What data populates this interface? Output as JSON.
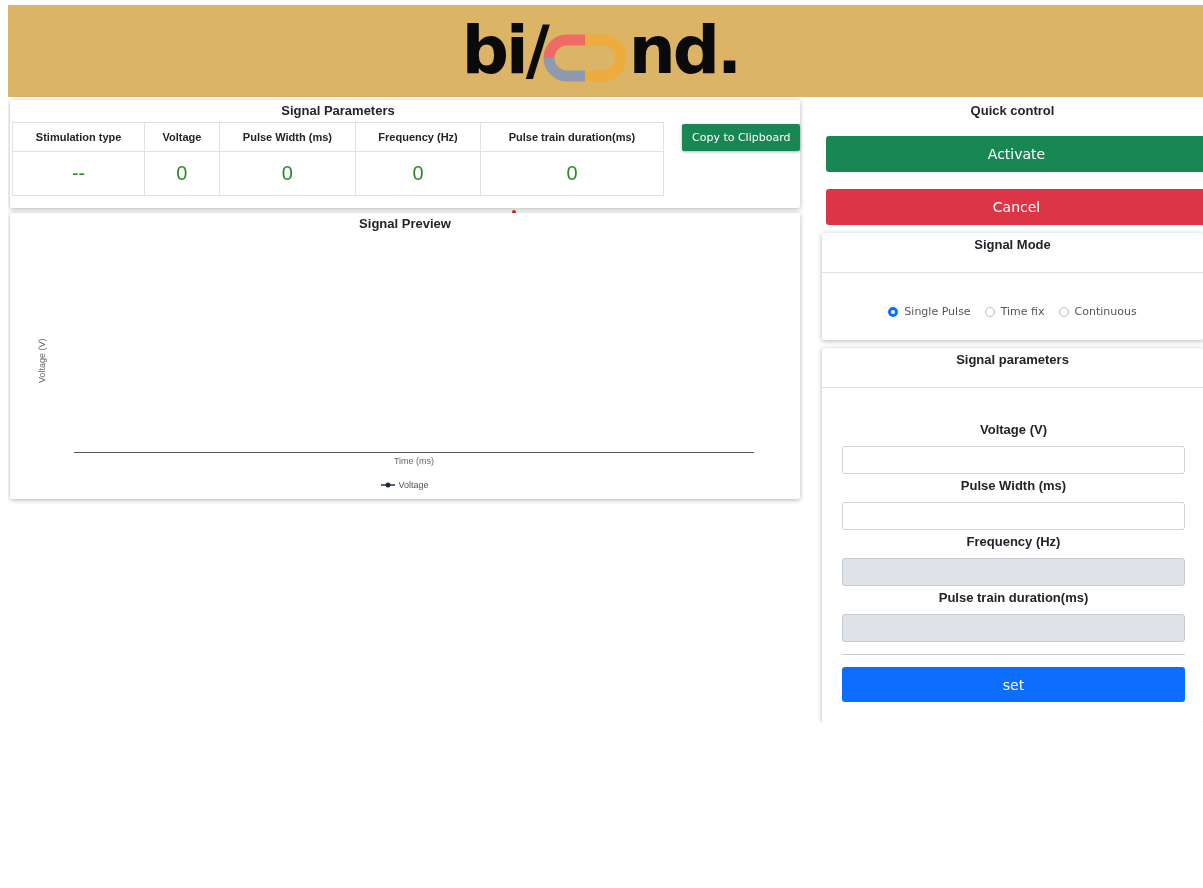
{
  "header": {
    "logo_left": "bi/",
    "logo_right": "nd."
  },
  "signal_parameters": {
    "title": "Signal Parameters",
    "columns": [
      "Stimulation type",
      "Voltage",
      "Pulse Width (ms)",
      "Frequency (Hz)",
      "Pulse train duration(ms)"
    ],
    "values": [
      "--",
      "0",
      "0",
      "0",
      "0"
    ],
    "copy_button": "Copy to Clipboard"
  },
  "signal_preview": {
    "title": "Signal Preview",
    "ylabel": "Voltage (V)",
    "xlabel": "Time (ms)",
    "legend": "Voltage"
  },
  "quick_control": {
    "title": "Quick control",
    "buttons": [
      {
        "label": "Activate",
        "kind": "success"
      },
      {
        "label": "Cancel",
        "kind": "danger"
      }
    ]
  },
  "signal_mode": {
    "title": "Signal Mode",
    "options": [
      {
        "label": "Single Pulse",
        "selected": true
      },
      {
        "label": "Time fix",
        "selected": false
      },
      {
        "label": "Continuous",
        "selected": false
      }
    ]
  },
  "signal_form": {
    "title": "Signal parameters",
    "fields": [
      {
        "label": "Voltage (V)",
        "disabled": false
      },
      {
        "label": "Pulse Width (ms)",
        "disabled": false
      },
      {
        "label": "Frequency (Hz)",
        "disabled": true
      },
      {
        "label": "Pulse train duration(ms)",
        "disabled": true
      }
    ],
    "submit": "set"
  }
}
